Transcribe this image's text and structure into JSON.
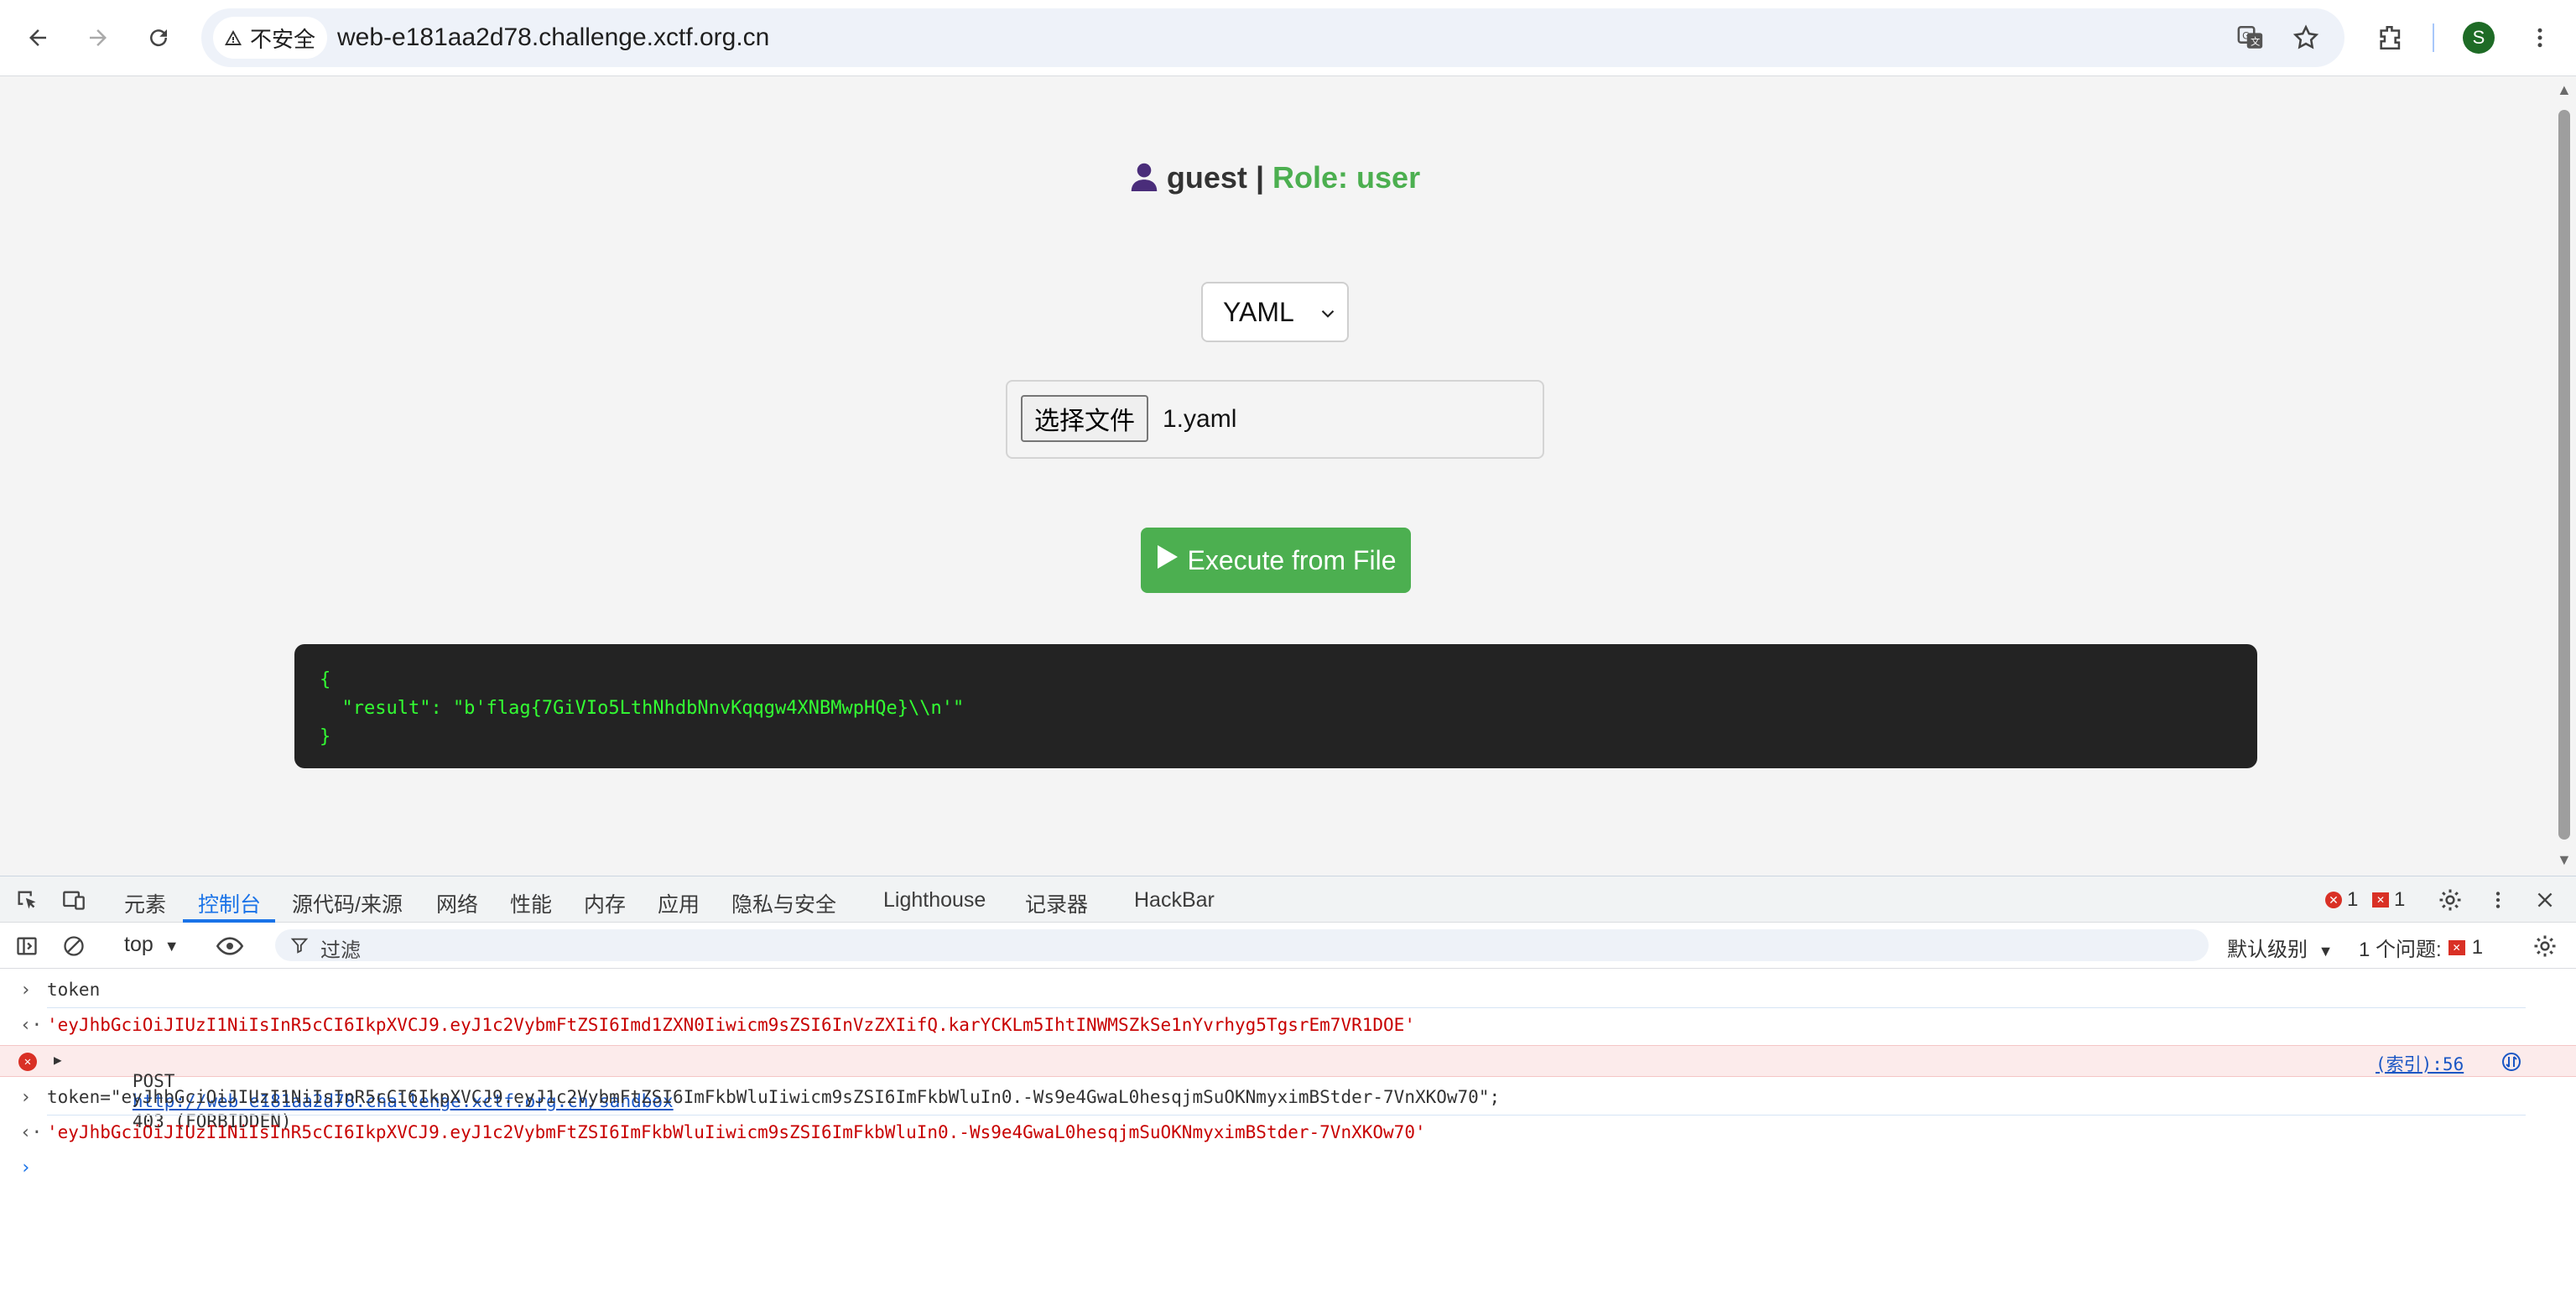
{
  "browser": {
    "security_label": "不安全",
    "url": "web-e181aa2d78.challenge.xctf.org.cn",
    "profile_initial": "S"
  },
  "page": {
    "username": "guest",
    "separator": "|",
    "role_label": "Role: user",
    "format_select": {
      "selected": "YAML"
    },
    "file_input": {
      "button_label": "选择文件",
      "file_name": "1.yaml"
    },
    "execute_label": "Execute from File",
    "result_lines": [
      "{",
      "  \"result\": \"b'flag{7GiVIo5LthNhdbNnvKqqgw4XNBMwpHQe}\\\\n'\"",
      "}"
    ]
  },
  "devtools": {
    "tabs": [
      "元素",
      "控制台",
      "源代码/来源",
      "网络",
      "性能",
      "内存",
      "应用",
      "隐私与安全",
      "Lighthouse",
      "记录器",
      "HackBar"
    ],
    "active_tab": "控制台",
    "error_count": "1",
    "issue_flag_count": "1",
    "context": "top",
    "filter_placeholder": "过滤",
    "log_level": "默认级别",
    "issues_label": "1 个问题:",
    "issues_count": "1",
    "console": [
      {
        "kind": "input",
        "text": "token"
      },
      {
        "kind": "output",
        "text": "'eyJhbGciOiJIUzI1NiIsInR5cCI6IkpXVCJ9.eyJ1c2VybmFtZSI6Imd1ZXN0Iiwicm9sZSI6InVzZXIifQ.karYCKLm5IhtINWMSZkSe1nYvrhyg5TgsrEm7VR1DOE'"
      },
      {
        "kind": "error",
        "method": "POST",
        "url": "http://web-e181aa2d78.challenge.xctf.org.cn/sandbox",
        "status": "403 (FORBIDDEN)",
        "source": "(索引):56"
      },
      {
        "kind": "input",
        "text": "token=\"eyJhbGciOiJIUzI1NiIsInR5cCI6IkpXVCJ9.eyJ1c2VybmFtZSI6ImFkbWluIiwicm9sZSI6ImFkbWluIn0.-Ws9e4GwaL0hesqjmSuOKNmyximBStder-7VnXKOw70\";"
      },
      {
        "kind": "output",
        "text": "'eyJhbGciOiJIUzI1NiIsInR5cCI6IkpXVCJ9.eyJ1c2VybmFtZSI6ImFkbWluIiwicm9sZSI6ImFkbWluIn0.-Ws9e4GwaL0hesqjmSuOKNmyximBStder-7VnXKOw70'"
      }
    ]
  }
}
